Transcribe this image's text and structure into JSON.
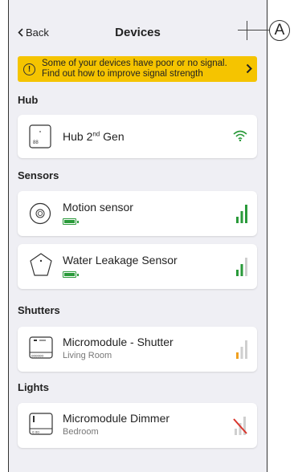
{
  "header": {
    "back_label": "Back",
    "title": "Devices",
    "callout": "A"
  },
  "banner": {
    "line1": "Some of your devices have poor or no signal.",
    "line2": "Find out how to improve signal strength"
  },
  "sections": {
    "hub": "Hub",
    "sensors": "Sensors",
    "shutters": "Shutters",
    "lights": "Lights"
  },
  "devices": {
    "hub": {
      "name": "Hub 2",
      "sup": "nd",
      "name_tail": " Gen",
      "signal": "wifi-strong"
    },
    "motion": {
      "name": "Motion sensor",
      "battery": "full",
      "signal": "strong"
    },
    "leak": {
      "name": "Water Leakage Sensor",
      "battery": "full",
      "signal": "medium"
    },
    "shutter": {
      "name": "Micromodule - Shutter",
      "room": "Living Room",
      "signal": "weak"
    },
    "dimmer": {
      "name": "Micromodule Dimmer",
      "room": "Bedroom",
      "signal": "none"
    }
  },
  "colors": {
    "accent_yellow": "#f5c400",
    "signal_green": "#2a9a3a",
    "signal_orange": "#f0a020",
    "no_signal_red": "#d9342b"
  }
}
